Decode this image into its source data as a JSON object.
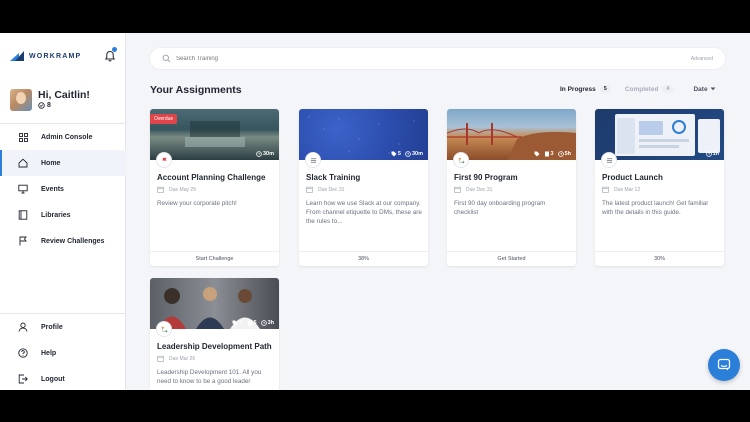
{
  "brand": {
    "name": "WORKRAMP",
    "accent": "#2b7fd9"
  },
  "user": {
    "greeting": "Hi, Caitlin!",
    "points": "8"
  },
  "nav": {
    "items": [
      {
        "label": "Admin Console",
        "icon": "grid-icon"
      },
      {
        "label": "Home",
        "icon": "home-icon",
        "active": true
      },
      {
        "label": "Events",
        "icon": "monitor-icon"
      },
      {
        "label": "Libraries",
        "icon": "book-icon"
      },
      {
        "label": "Review Challenges",
        "icon": "flag-icon"
      }
    ],
    "bottom": [
      {
        "label": "Profile",
        "icon": "user-icon"
      },
      {
        "label": "Help",
        "icon": "help-icon"
      },
      {
        "label": "Logout",
        "icon": "logout-icon"
      }
    ]
  },
  "search": {
    "placeholder": "Search Training",
    "advanced": "Advanced"
  },
  "section_title": "Your Assignments",
  "filters": {
    "in_progress": {
      "label": "In Progress",
      "count": "5"
    },
    "completed": {
      "label": "Completed",
      "count": "4"
    },
    "sort": "Date"
  },
  "cards": [
    {
      "title": "Account Planning Challenge",
      "due": "Due May 29",
      "desc": "Review your corporate pitch!",
      "footer": "Start Challenge",
      "badge": "Overdue",
      "time": "30m",
      "tags": "",
      "items": ""
    },
    {
      "title": "Slack Training",
      "due": "Due Dec 31",
      "desc": "Learn how we use Slack at our company. From channel etiquette to DMs, these are the rules to...",
      "footer": "38%",
      "time": "30m",
      "tags": "5",
      "items": ""
    },
    {
      "title": "First 90 Program",
      "due": "Due Dec 31",
      "desc": "First 90 day onboarding program checklist",
      "footer": "Get Started",
      "time": "5h",
      "tags": "",
      "items": "3"
    },
    {
      "title": "Product Launch",
      "due": "Due Mar 12",
      "desc": "The latest product launch! Get familiar with the details in this guide.",
      "footer": "30%",
      "time": "1h",
      "tags": "",
      "items": ""
    },
    {
      "title": "Leadership Development Path",
      "due": "Due Mar 26",
      "desc": "Leadership Development 101. All you need to know to be a good leader",
      "footer": "",
      "time": "3h",
      "tags": "1",
      "items": "5"
    }
  ]
}
